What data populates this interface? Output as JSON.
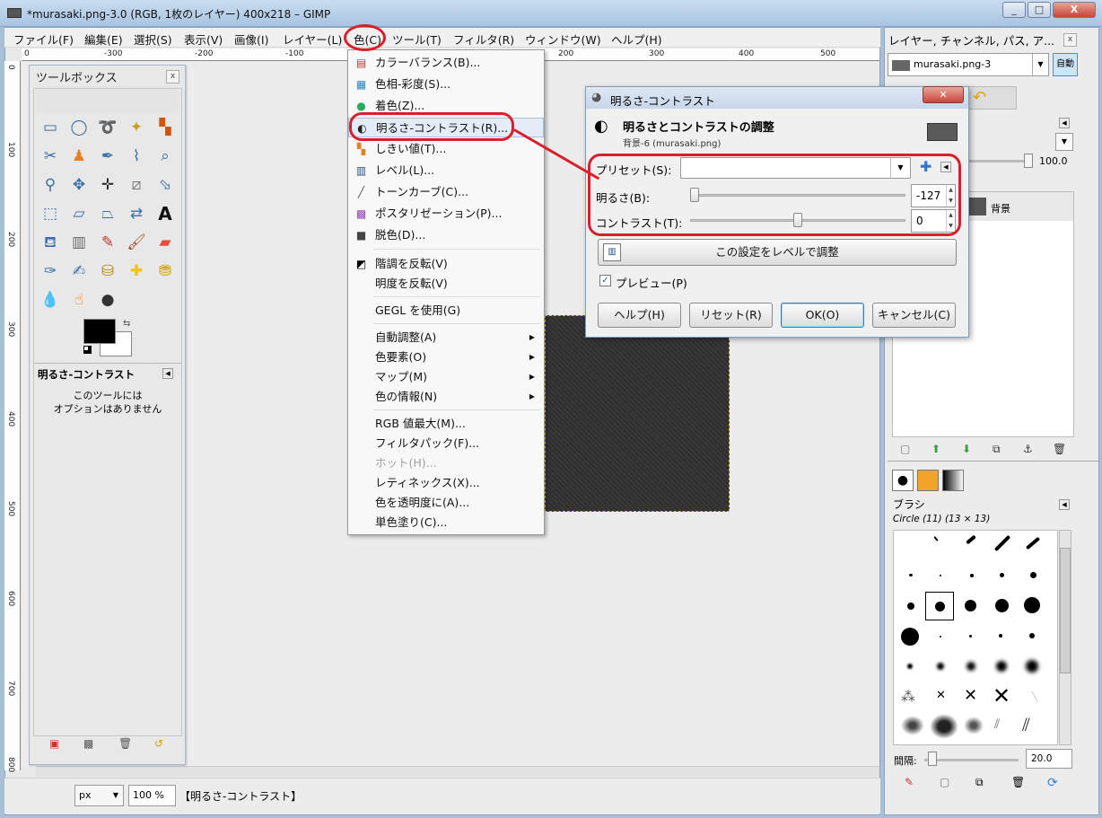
{
  "window": {
    "title": "*murasaki.png-3.0 (RGB, 1枚のレイヤー) 400x218 – GIMP",
    "minimize": "_",
    "maximize": "□",
    "close": "X"
  },
  "menubar": [
    "ファイル(F)",
    "編集(E)",
    "選択(S)",
    "表示(V)",
    "画像(I)",
    "レイヤー(L)",
    "色(C)",
    "ツール(T)",
    "フィルタ(R)",
    "ウィンドウ(W)",
    "ヘルプ(H)"
  ],
  "ruler_h": [
    "0",
    "-300",
    "-200",
    "-100",
    "0",
    "100",
    "200",
    "300",
    "400",
    "500"
  ],
  "ruler_v": [
    "0",
    "100",
    "200",
    "300",
    "400",
    "500",
    "600",
    "700",
    "800"
  ],
  "toolbox": {
    "title": "ツールボックス",
    "close": "x",
    "options_title": "明るさ-コントラスト",
    "options_text_1": "このツールには",
    "options_text_2": "オプションはありません"
  },
  "color_menu": {
    "items": [
      {
        "label": "カラーバランス(B)...",
        "icon": "color-balance-icon",
        "glyph": "▤",
        "color": "#c0392b"
      },
      {
        "label": "色相-彩度(S)...",
        "icon": "hue-saturation-icon",
        "glyph": "▦",
        "color": "#2e86c1"
      },
      {
        "label": "着色(Z)...",
        "icon": "colorize-icon",
        "glyph": "●",
        "color": "#27ae60"
      },
      {
        "label": "明るさ-コントラスト(R)...",
        "icon": "brightness-contrast-icon",
        "glyph": "◐",
        "color": "#222222"
      },
      {
        "label": "しきい値(T)...",
        "icon": "threshold-icon",
        "glyph": "▚",
        "color": "#e67e22"
      },
      {
        "label": "レベル(L)...",
        "icon": "levels-icon",
        "glyph": "▥",
        "color": "#1f4e79"
      },
      {
        "label": "トーンカーブ(C)...",
        "icon": "curves-icon",
        "glyph": "╱",
        "color": "#555555"
      },
      {
        "label": "ポスタリゼーション(P)...",
        "icon": "posterize-icon",
        "glyph": "▩",
        "color": "#8e44ad"
      },
      {
        "label": "脱色(D)...",
        "icon": "desaturate-icon",
        "glyph": "■",
        "color": "#444444"
      },
      {
        "label": "階調を反転(V)",
        "icon": "invert-icon",
        "glyph": "◩",
        "color": "#000000"
      },
      {
        "label": "明度を反転(V)",
        "icon": "",
        "glyph": "",
        "color": "#000000"
      },
      {
        "label": "GEGL を使用(G)",
        "icon": "",
        "glyph": "",
        "color": "#000000"
      },
      {
        "label": "自動調整(A)",
        "icon": "",
        "glyph": "",
        "color": "#000000",
        "submenu": "▶"
      },
      {
        "label": "色要素(O)",
        "icon": "",
        "glyph": "",
        "color": "#000000",
        "submenu": "▶"
      },
      {
        "label": "マップ(M)",
        "icon": "",
        "glyph": "",
        "color": "#000000",
        "submenu": "▶"
      },
      {
        "label": "色の情報(N)",
        "icon": "",
        "glyph": "",
        "color": "#000000",
        "submenu": "▶"
      },
      {
        "label": "RGB 値最大(M)...",
        "icon": "",
        "glyph": "",
        "color": "#000000"
      },
      {
        "label": "フィルタパック(F)...",
        "icon": "",
        "glyph": "",
        "color": "#000000"
      },
      {
        "label": "ホット(H)...",
        "icon": "",
        "glyph": "",
        "color": "#000000",
        "disabled": true
      },
      {
        "label": "レティネックス(X)...",
        "icon": "",
        "glyph": "",
        "color": "#000000"
      },
      {
        "label": "色を透明度に(A)...",
        "icon": "",
        "glyph": "",
        "color": "#000000"
      },
      {
        "label": "単色塗り(C)...",
        "icon": "",
        "glyph": "",
        "color": "#000000"
      }
    ]
  },
  "dialog": {
    "title": "明るさ-コントラスト",
    "heading": "明るさとコントラストの調整",
    "subheading": "背景-6 (murasaki.png)",
    "preset_label": "プリセット(S):",
    "preset_value": "",
    "brightness_label": "明るさ(B):",
    "brightness_value": "-127",
    "brightness": -127,
    "contrast_label": "コントラスト(T):",
    "contrast_value": "0",
    "contrast": 0,
    "levels_button": "この設定をレベルで調整",
    "preview_label": "プレビュー(P)",
    "preview_checked": true,
    "help_button": "ヘルプ(H)",
    "reset_button": "リセット(R)",
    "ok_button": "OK(O)",
    "cancel_button": "キャンセル(C)"
  },
  "dock": {
    "title": "レイヤー, チャンネル, パス, ア...",
    "image_select": "murasaki.png-3",
    "auto_button": "自動",
    "opacity": "100.0",
    "layer_name": "背景",
    "brushes_title": "ブラシ",
    "brush_name": "Circle (11) (13 × 13)",
    "spacing_label": "間隔:",
    "spacing_value": "20.0"
  },
  "statusbar": {
    "unit": "px",
    "zoom": "100 %",
    "message": "【明るさ-コントラスト】"
  },
  "accent_red": "#d7202b"
}
